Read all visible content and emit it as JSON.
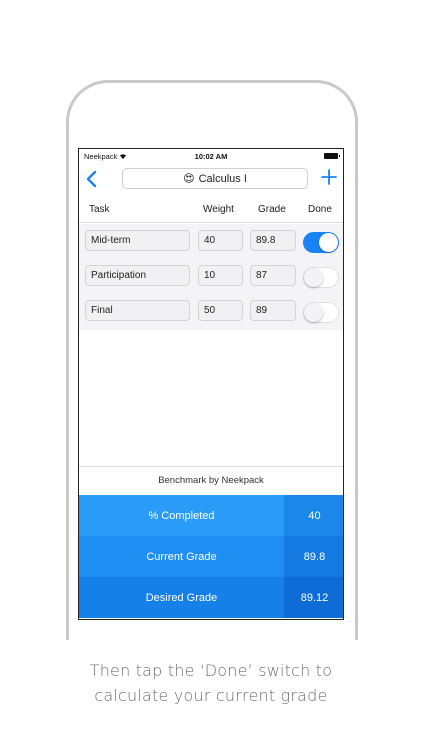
{
  "status_bar": {
    "carrier": "Neekpack",
    "time": "10:02 AM",
    "wifi_icon": "wifi-icon",
    "battery_icon": "battery-icon"
  },
  "navbar": {
    "back_icon": "chevron-left-icon",
    "title_emoji": "😍",
    "title": "Calculus I",
    "add_icon": "plus-icon",
    "accent_color": "#1a82f7"
  },
  "columns": {
    "task": "Task",
    "weight": "Weight",
    "grade": "Grade",
    "done": "Done"
  },
  "tasks": [
    {
      "name": "Mid-term",
      "weight": "40",
      "grade": "89.8",
      "done": true
    },
    {
      "name": "Participation",
      "weight": "10",
      "grade": "87",
      "done": false
    },
    {
      "name": "Final",
      "weight": "50",
      "grade": "89",
      "done": false
    }
  ],
  "benchmark": {
    "label": "Benchmark by Neekpack"
  },
  "stats": [
    {
      "label": "% Completed",
      "value": "40"
    },
    {
      "label": "Current Grade",
      "value": "89.8"
    },
    {
      "label": "Desired Grade",
      "value": "89.12"
    }
  ],
  "caption": {
    "line1": "Then tap the ‘Done’ switch to",
    "line2": "calculate your current grade"
  }
}
